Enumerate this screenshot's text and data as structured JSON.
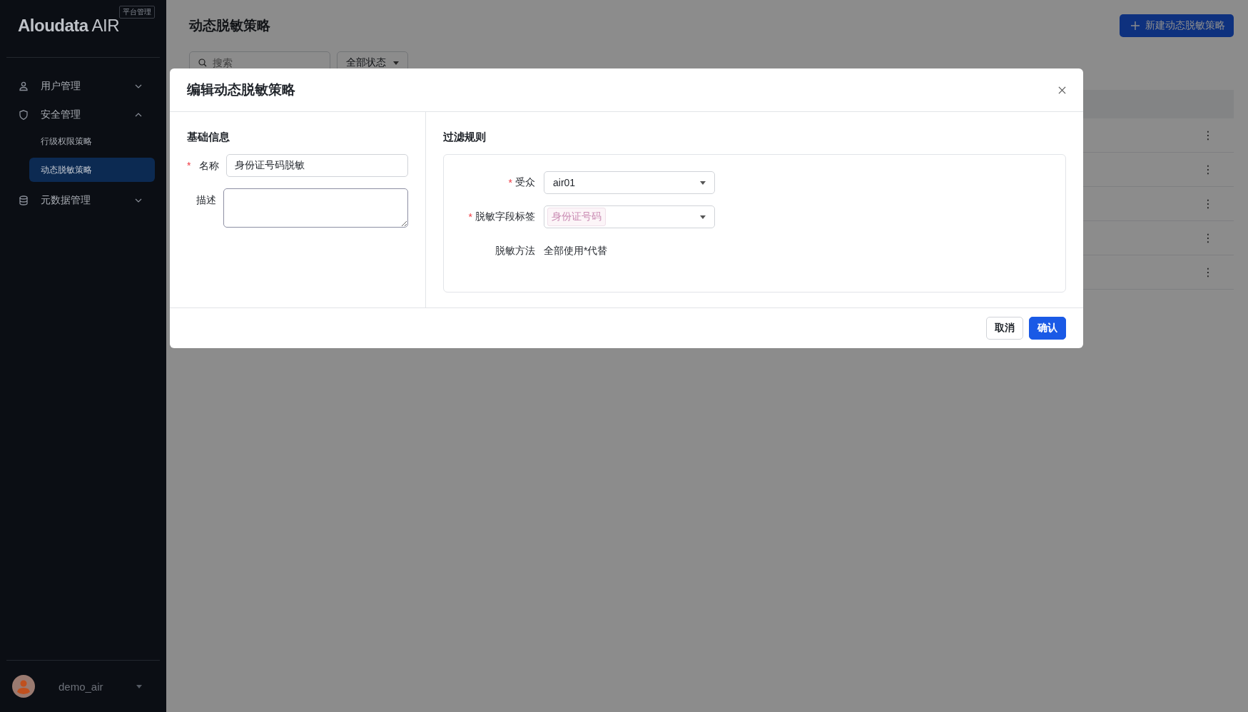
{
  "sidebar": {
    "logo": {
      "brand": "Aloudata",
      "product": "AIR"
    },
    "badge": "平台管理",
    "menu": [
      {
        "kind": "group",
        "label": "用户管理",
        "expanded": false
      },
      {
        "kind": "group",
        "label": "安全管理",
        "expanded": true,
        "children": [
          {
            "label": "行级权限策略",
            "selected": false
          },
          {
            "label": "动态脱敏策略",
            "selected": true
          }
        ]
      },
      {
        "kind": "group",
        "label": "元数据管理",
        "expanded": false
      }
    ],
    "user": {
      "name": "demo_air"
    }
  },
  "page": {
    "title": "动态脱敏策略",
    "new_button": "新建动态脱敏策略",
    "search": {
      "placeholder": "搜索"
    },
    "status_filter": "全部状态",
    "table": {
      "rows": [
        {
          "actions": "⋮"
        },
        {
          "actions": "⋮"
        },
        {
          "actions": "⋮"
        },
        {
          "actions": "⋮"
        },
        {
          "actions": "⋮"
        }
      ]
    }
  },
  "dialog": {
    "title": "编辑动态脱敏策略",
    "basic": {
      "heading": "基础信息",
      "fields": [
        {
          "kind": "input",
          "label": "名称",
          "mark": "*",
          "value": "身份证号码脱敏"
        },
        {
          "kind": "textarea",
          "label": "描述"
        }
      ]
    },
    "rules": {
      "heading": "过滤规则",
      "fields": [
        {
          "kind": "select",
          "label": "受众",
          "mark": "*",
          "value": "air01"
        },
        {
          "kind": "tags",
          "label": "脱敏字段标签",
          "mark": "*",
          "tags": [
            "身份证号码"
          ]
        },
        {
          "kind": "text",
          "label": "脱敏方法",
          "value": "全部使用*代替"
        }
      ]
    },
    "buttons": [
      {
        "label": "取消",
        "primary": false
      },
      {
        "label": "确认",
        "primary": true
      }
    ]
  }
}
